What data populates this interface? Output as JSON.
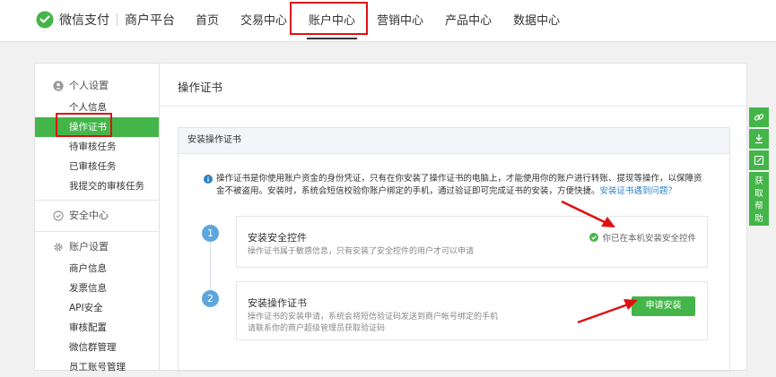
{
  "header": {
    "brand": "微信支付",
    "brand_sub": "商户平台",
    "nav": [
      {
        "label": "首页"
      },
      {
        "label": "交易中心"
      },
      {
        "label": "账户中心"
      },
      {
        "label": "营销中心"
      },
      {
        "label": "产品中心"
      },
      {
        "label": "数据中心"
      }
    ],
    "active_nav": "账户中心"
  },
  "sidebar": {
    "groups": [
      {
        "title": "个人设置",
        "icon": "person-icon",
        "items": [
          "个人信息",
          "操作证书",
          "待审核任务",
          "已审核任务",
          "我提交的审核任务"
        ]
      },
      {
        "title": "安全中心",
        "icon": "shield-icon",
        "items": []
      },
      {
        "title": "账户设置",
        "icon": "gear-icon",
        "items": [
          "商户信息",
          "发票信息",
          "API安全",
          "审核配置",
          "微信群管理",
          "员工账号管理"
        ]
      }
    ],
    "active_item": "操作证书"
  },
  "main": {
    "title": "操作证书",
    "panel_title": "安装操作证书",
    "info": "操作证书是你使用账户资金的身份凭证，只有在你安装了操作证书的电脑上，才能使用你的账户进行转账、提现等操作，以保障资金不被盗用。安装时，系统会短信校验你账户绑定的手机，通过验证即可完成证书的安装，方便快捷。",
    "info_link": "安装证书遇到问题？",
    "steps": [
      {
        "num": "1",
        "title": "安装安全控件",
        "desc": "操作证书属于敏感信息，只有安装了安全控件的用户才可以申请",
        "status": "你已在本机安装安全控件"
      },
      {
        "num": "2",
        "title": "安装操作证书",
        "desc1": "操作证书的安装申请，系统会将短信验证码发送到商户帐号绑定的手机",
        "desc2": "请联系你的商户超级管理员获取验证码",
        "button": "申请安装"
      }
    ]
  },
  "float_bar": {
    "icons": [
      "link-icon",
      "download-icon",
      "edit-icon"
    ],
    "help": [
      "获",
      "取",
      "帮",
      "助"
    ]
  },
  "colors": {
    "brand_green": "#44b549",
    "link_blue": "#2d82c6",
    "step_blue": "#5ea6dd",
    "annotation_red": "#e01010"
  }
}
